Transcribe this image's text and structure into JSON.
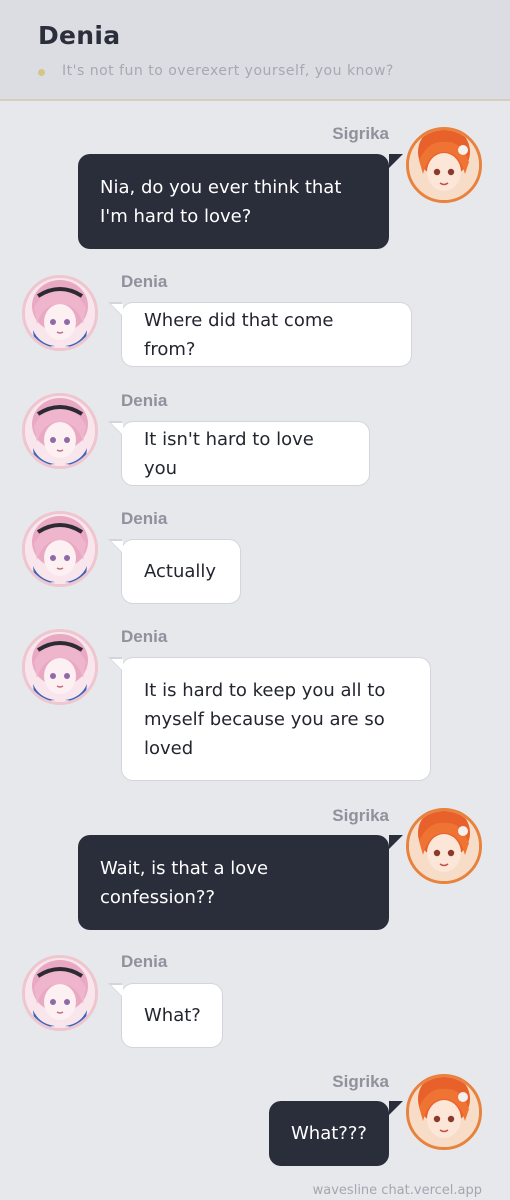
{
  "header": {
    "title": "Denia",
    "status": "It's not fun to overexert yourself, you know?"
  },
  "messages": [
    {
      "sender": "Sigrika",
      "side": "right",
      "text": "Nia, do you ever think that I'm hard to love?"
    },
    {
      "sender": "Denia",
      "side": "left",
      "text": "Where did that come from?"
    },
    {
      "sender": "Denia",
      "side": "left",
      "text": "It isn't hard to love you"
    },
    {
      "sender": "Denia",
      "side": "left",
      "text": "Actually"
    },
    {
      "sender": "Denia",
      "side": "left",
      "text": "It is hard to keep you all to myself because you are so loved"
    },
    {
      "sender": "Sigrika",
      "side": "right",
      "text": "Wait, is that a love confession??"
    },
    {
      "sender": "Denia",
      "side": "left",
      "text": "What?"
    },
    {
      "sender": "Sigrika",
      "side": "right",
      "text": "What???"
    }
  ],
  "footer": "wavesline chat.vercel.app",
  "colors": {
    "background": "#e7e8ec",
    "dark_bubble": "#2a2e3a",
    "light_bubble": "#ffffff",
    "sigrika_ring": "#e8823c",
    "denia_ring": "#efc5cf"
  }
}
